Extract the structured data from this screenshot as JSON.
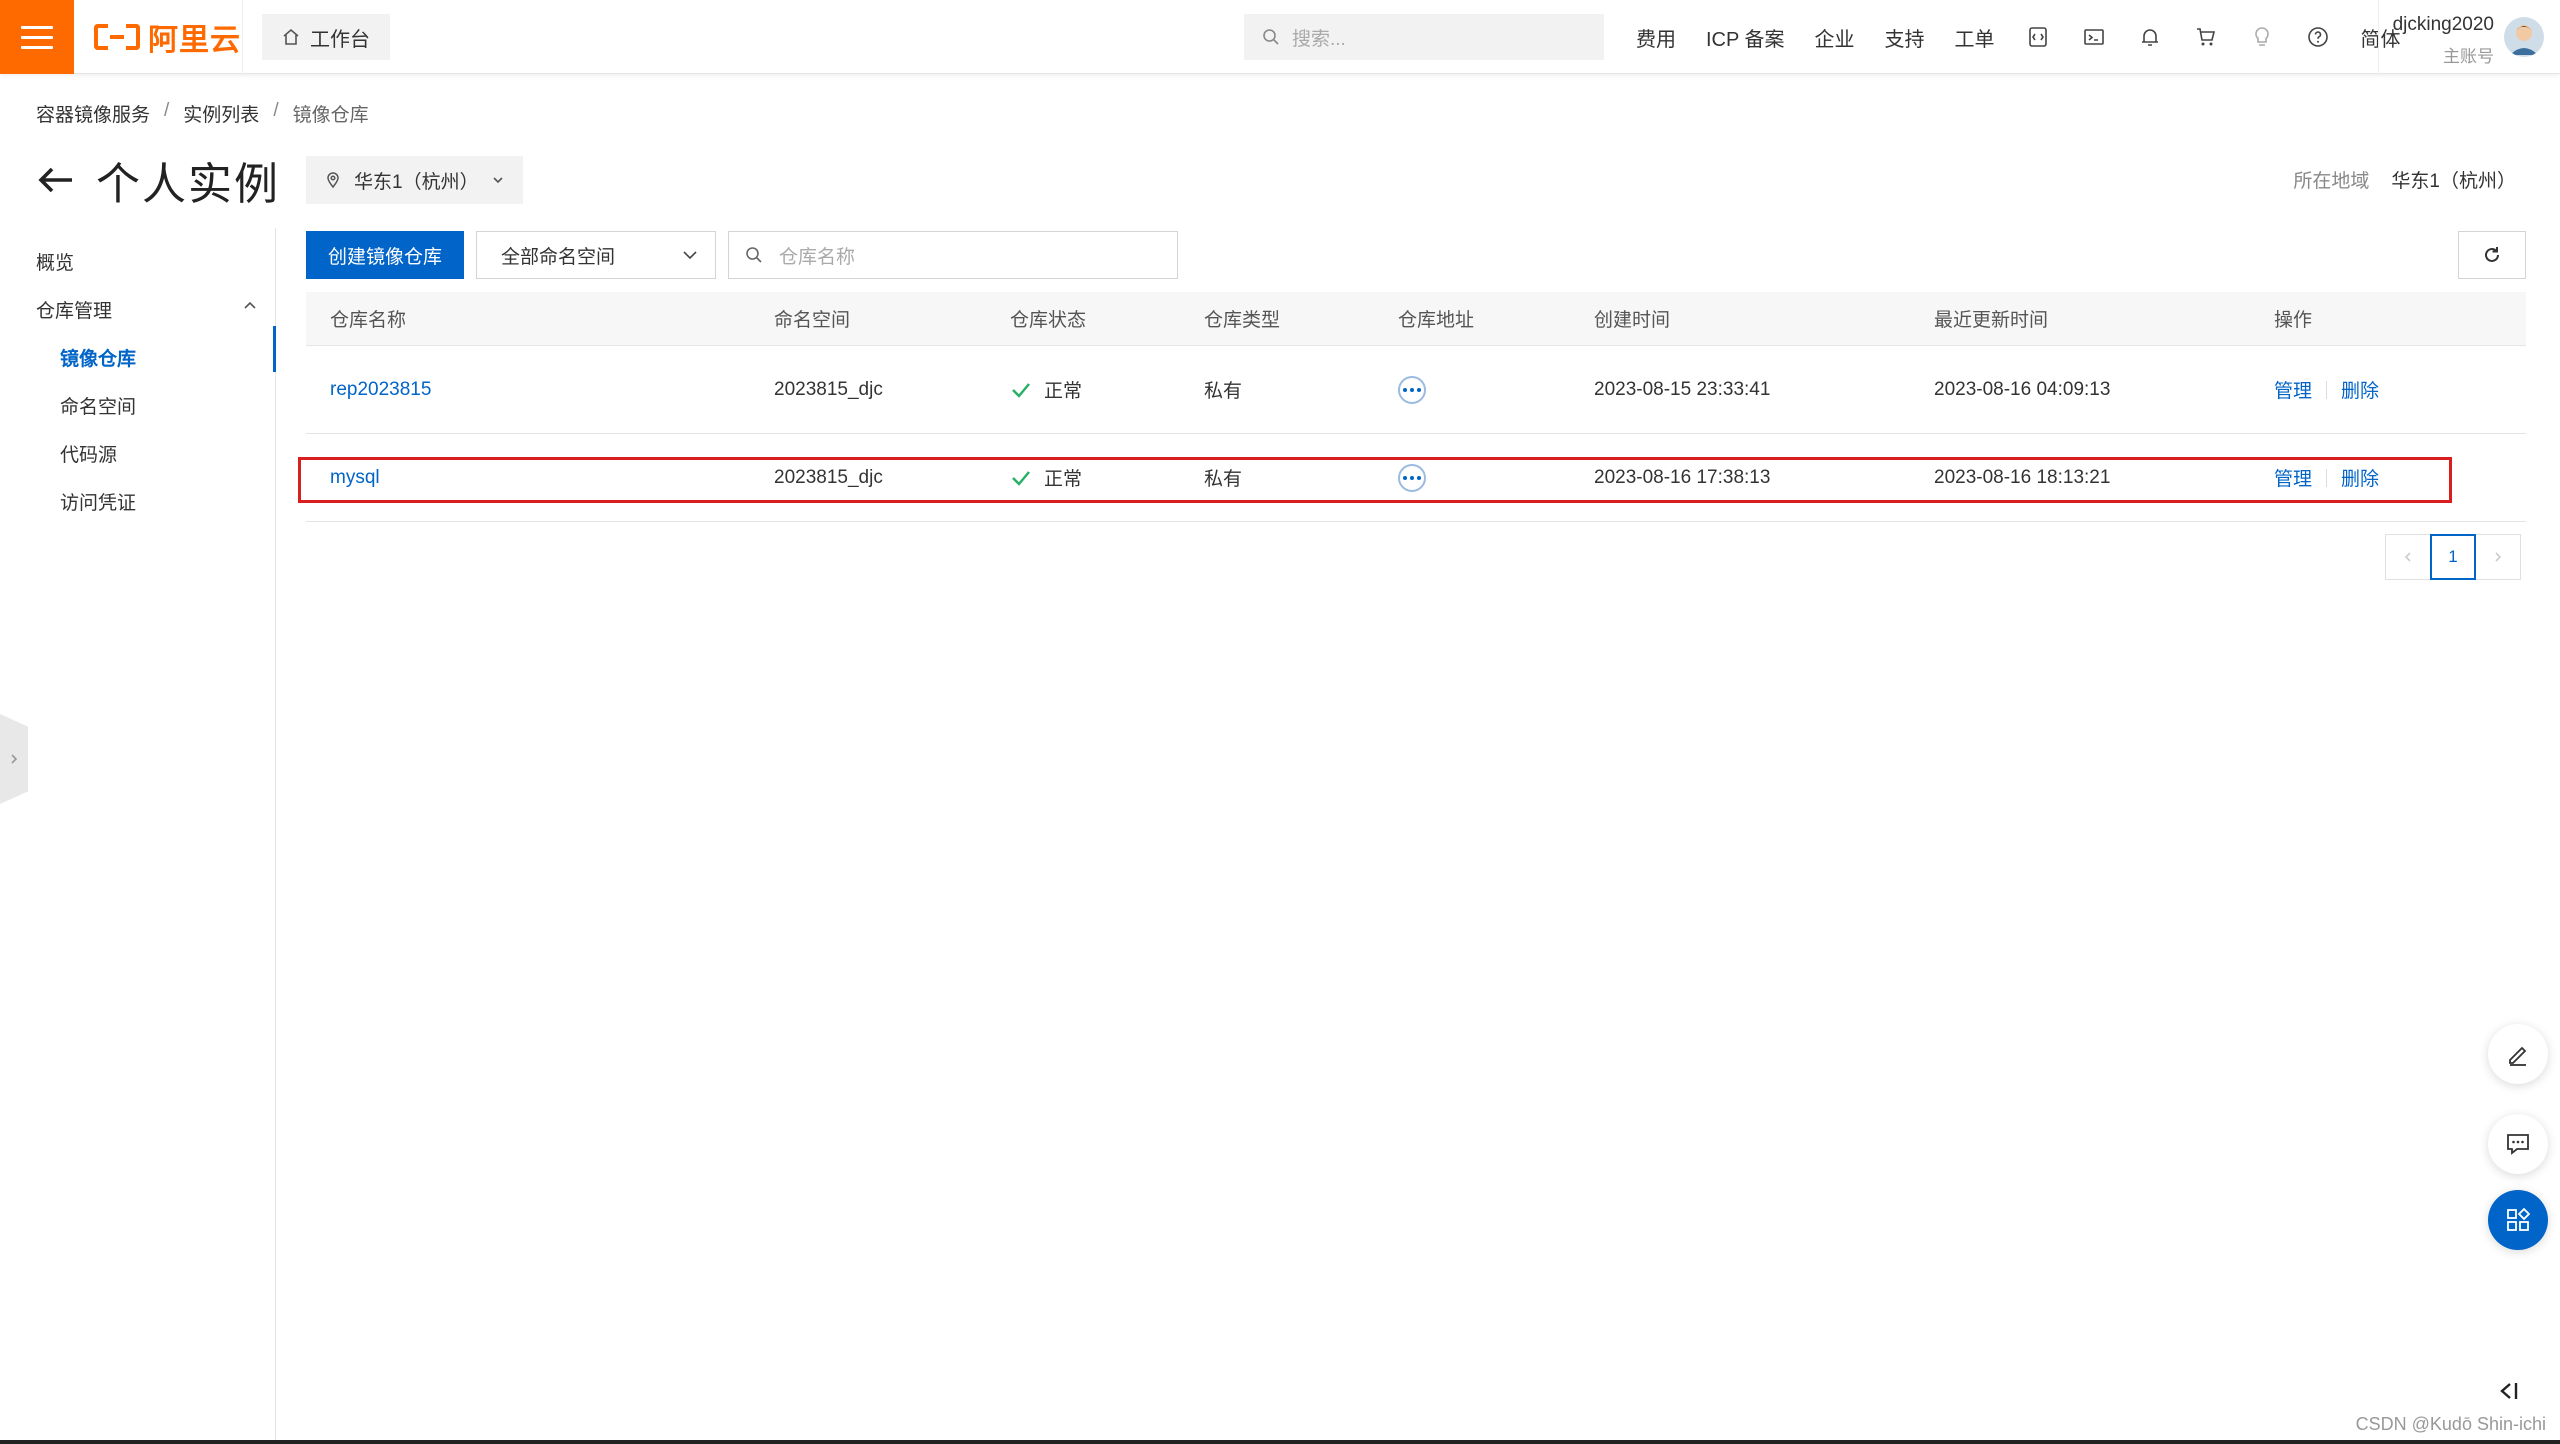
{
  "topbar": {
    "brand": "阿里云",
    "workbench": "工作台",
    "search_placeholder": "搜索...",
    "links": [
      "费用",
      "ICP 备案",
      "企业",
      "支持",
      "工单"
    ],
    "lang": "简体",
    "username": "djcking2020",
    "role": "主账号"
  },
  "breadcrumb": [
    "容器镜像服务",
    "实例列表",
    "镜像仓库"
  ],
  "page": {
    "title": "个人实例",
    "region_select": "华东1（杭州）",
    "region_label": "所在地域",
    "region_value": "华东1（杭州）"
  },
  "sidebar": {
    "overview": "概览",
    "repo_mgmt": "仓库管理",
    "sub_items": [
      "镜像仓库",
      "命名空间",
      "代码源",
      "访问凭证"
    ]
  },
  "toolbar": {
    "create_button": "创建镜像仓库",
    "namespace_select": "全部命名空间",
    "search_placeholder": "仓库名称"
  },
  "table": {
    "headers": [
      "仓库名称",
      "命名空间",
      "仓库状态",
      "仓库类型",
      "仓库地址",
      "创建时间",
      "最近更新时间",
      "操作"
    ],
    "rows": [
      {
        "name": "rep2023815",
        "namespace": "2023815_djc",
        "status": "正常",
        "type": "私有",
        "created": "2023-08-15 23:33:41",
        "updated": "2023-08-16 04:09:13",
        "action_manage": "管理",
        "action_delete": "删除"
      },
      {
        "name": "mysql",
        "namespace": "2023815_djc",
        "status": "正常",
        "type": "私有",
        "created": "2023-08-16 17:38:13",
        "updated": "2023-08-16 18:13:21",
        "action_manage": "管理",
        "action_delete": "删除"
      }
    ]
  },
  "pagination": {
    "current": "1"
  },
  "watermark": "CSDN @Kudō Shin-ichi",
  "colors": {
    "brand_orange": "#ff6a00",
    "primary_blue": "#0064c8",
    "highlight_red": "#d81e1e",
    "status_green": "#23b066"
  }
}
